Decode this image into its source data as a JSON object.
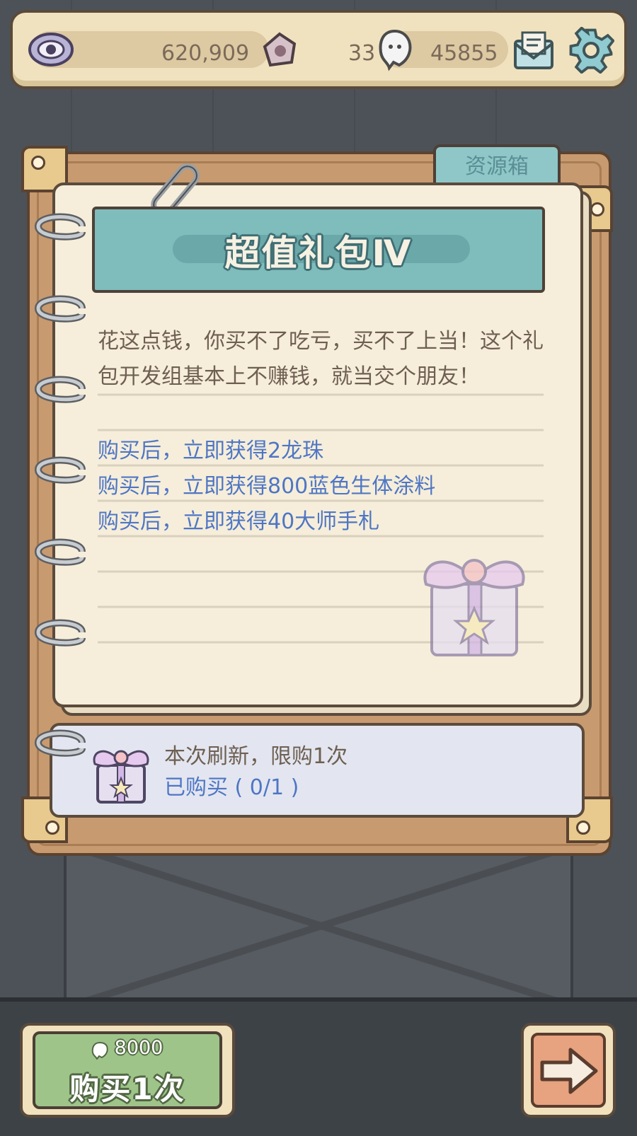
{
  "topbar": {
    "eye_value": "620,909",
    "coin_value": "33",
    "ghost_value": "45855",
    "icons": [
      "eye-icon",
      "coin-icon",
      "ghost-icon",
      "mail-icon",
      "gear-icon"
    ]
  },
  "tab": {
    "label": "资源箱"
  },
  "pack": {
    "title": "超值礼包Ⅳ",
    "description": "花这点钱，你买不了吃亏，买不了上当！这个礼包开发组基本上不赚钱，就当交个朋友！",
    "rewards": [
      "购买后，立即获得2龙珠",
      "购买后，立即获得800蓝色生体涂料",
      "购买后，立即获得40大师手札"
    ]
  },
  "status": {
    "limit": "本次刷新，限购1次",
    "purchased": "已购买 ( 0/1 )"
  },
  "buy": {
    "price": "8000",
    "label": "购买1次"
  },
  "colors": {
    "reward_text": "#4f76c4",
    "banner": "#7fbcbc",
    "buy_button": "#9fc48a",
    "next_button": "#e7a27f"
  }
}
